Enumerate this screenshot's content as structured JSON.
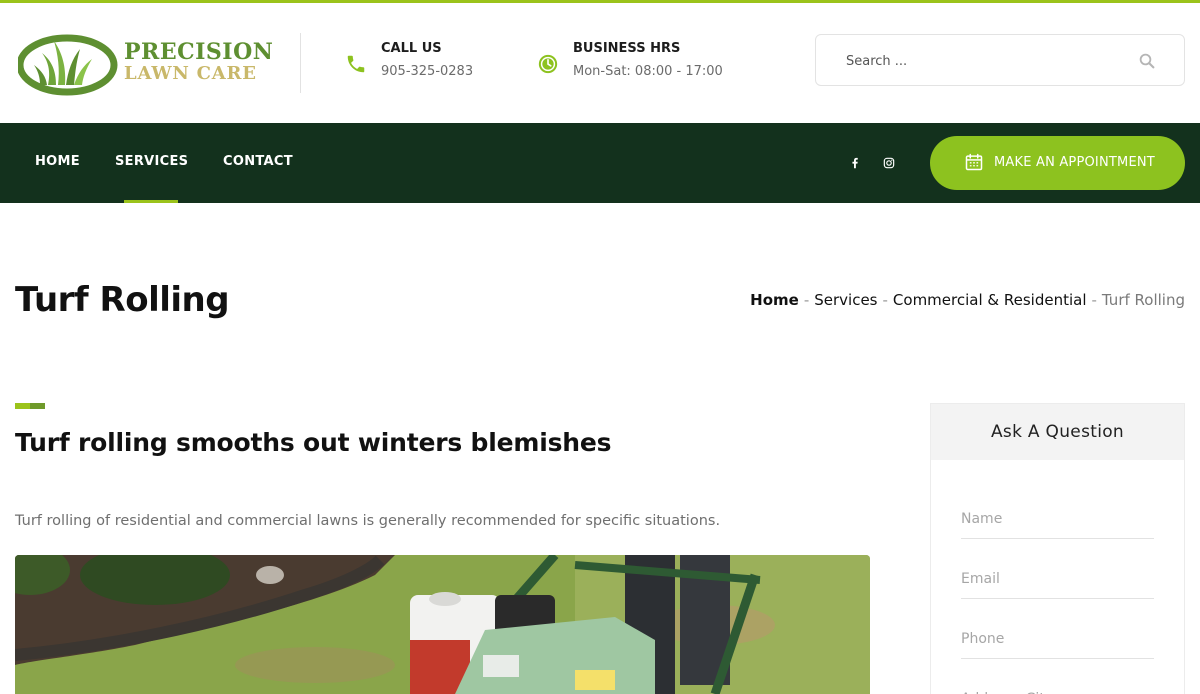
{
  "brand": {
    "name_line1": "PRECISION",
    "name_line2": "LAWN CARE",
    "accent_color": "#9bc31b",
    "nav_bg_color": "#13311d"
  },
  "header": {
    "call": {
      "title": "CALL US",
      "value": "905-325-0283",
      "icon": "phone-icon"
    },
    "hours": {
      "title": "BUSINESS HRS",
      "value": "Mon-Sat: 08:00 - 17:00",
      "icon": "clock-icon"
    },
    "search": {
      "placeholder": "Search ...",
      "icon": "search-icon"
    }
  },
  "nav": {
    "items": [
      {
        "label": "HOME",
        "active": false
      },
      {
        "label": "SERVICES",
        "active": true
      },
      {
        "label": "CONTACT",
        "active": false
      }
    ],
    "social": [
      "facebook-icon",
      "instagram-icon"
    ],
    "appointment_label": "MAKE AN APPOINTMENT",
    "appointment_icon": "calendar-icon"
  },
  "page": {
    "title": "Turf Rolling",
    "breadcrumb": [
      "Home",
      "Services",
      "Commercial & Residential",
      "Turf Rolling"
    ]
  },
  "main": {
    "heading": "Turf rolling smooths out winters blemishes",
    "intro": "Turf rolling of residential and commercial lawns is generally recommended for specific situations."
  },
  "sidebar": {
    "title": "Ask A Question",
    "fields": {
      "name": "Name",
      "email": "Email",
      "phone": "Phone",
      "address": "Address, City"
    }
  }
}
